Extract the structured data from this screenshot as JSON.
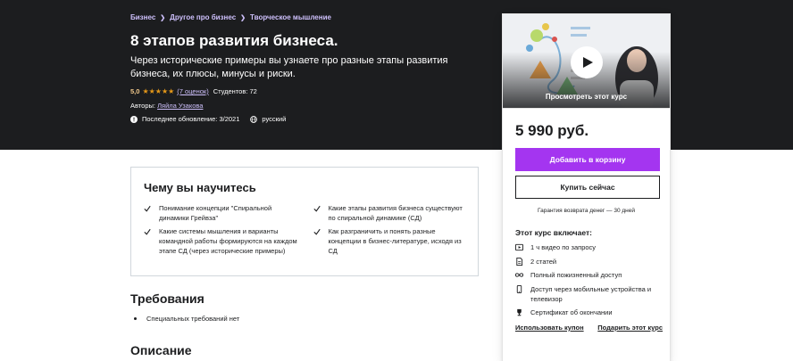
{
  "breadcrumb": [
    "Бизнес",
    "Другое про бизнес",
    "Творческое мышление"
  ],
  "course": {
    "title": "8 этапов развития бизнеса.",
    "subtitle": "Через исторические примеры вы узнаете про разные этапы развития бизнеса, их плюсы, минусы и риски.",
    "rating": "5,0",
    "rating_value": 5,
    "stars": "★★★★★",
    "reviews": "(7 оценок)",
    "students": "Студентов: 72",
    "authors_label": "Авторы:",
    "author": "Ляйла Узакова",
    "updated": "Последнее обновление: 3/2021",
    "language": "русский"
  },
  "sidebar": {
    "preview_label": "Просмотреть этот курс",
    "price": "5 990 руб.",
    "add_to_cart": "Добавить в корзину",
    "buy_now": "Купить сейчас",
    "guarantee": "Гарантия возврата денег — 30 дней",
    "includes_title": "Этот курс включает:",
    "includes": [
      {
        "icon": "video-icon",
        "text": "1 ч видео по запросу"
      },
      {
        "icon": "file-icon",
        "text": "2 статей"
      },
      {
        "icon": "infinity-icon",
        "text": "Полный пожизненный доступ"
      },
      {
        "icon": "mobile-icon",
        "text": "Доступ через мобильные устройства и телевизор"
      },
      {
        "icon": "trophy-icon",
        "text": "Сертификат об окончании"
      }
    ],
    "apply_coupon": "Использовать купон",
    "gift_course": "Подарить этот курс"
  },
  "learn": {
    "title": "Чему вы научитесь",
    "items": [
      "Понимание концепции \"Спиральной динамики Грейвза\"",
      "Какие этапы развития бизнеса существуют по спиральной динамике (СД)",
      "Какие системы мышления и варианты командной работы формируются на каждом этапе СД (через исторические примеры)",
      "Как разграничить и понять разные концепции в бизнес-литературе, исходя из СД"
    ]
  },
  "requirements": {
    "title": "Требования",
    "items": [
      "Специальных требований нет"
    ]
  },
  "description": {
    "title": "Описание"
  },
  "colors": {
    "hero_bg": "#1c1d1f",
    "accent_purple": "#a435f0",
    "link_lavender": "#cec0fc",
    "star_orange": "#e59819"
  }
}
